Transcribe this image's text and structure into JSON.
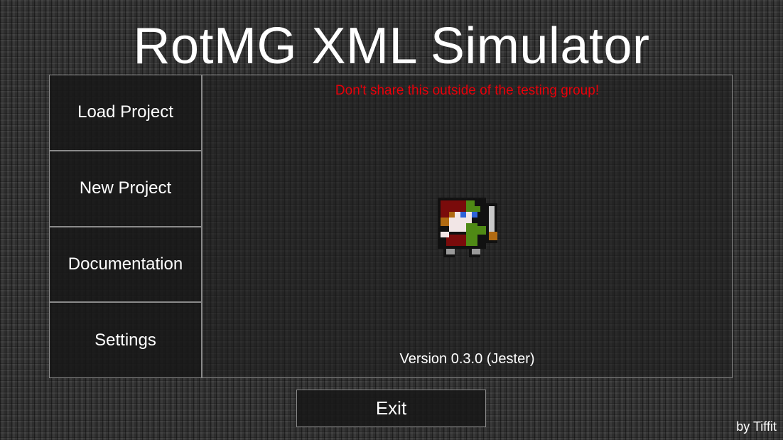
{
  "app": {
    "title": "RotMG XML Simulator",
    "credit": "by Tiffit"
  },
  "sidebar": {
    "items": [
      {
        "label": "Load Project"
      },
      {
        "label": "New Project"
      },
      {
        "label": "Documentation"
      },
      {
        "label": "Settings"
      }
    ]
  },
  "content": {
    "warning": "Don't share this outside of the testing group!",
    "warning_color": "#e8000a",
    "sprite_icon": "pixel-character-sprite-icon",
    "version": "Version 0.3.0 (Jester)"
  },
  "footer": {
    "exit_label": "Exit"
  }
}
